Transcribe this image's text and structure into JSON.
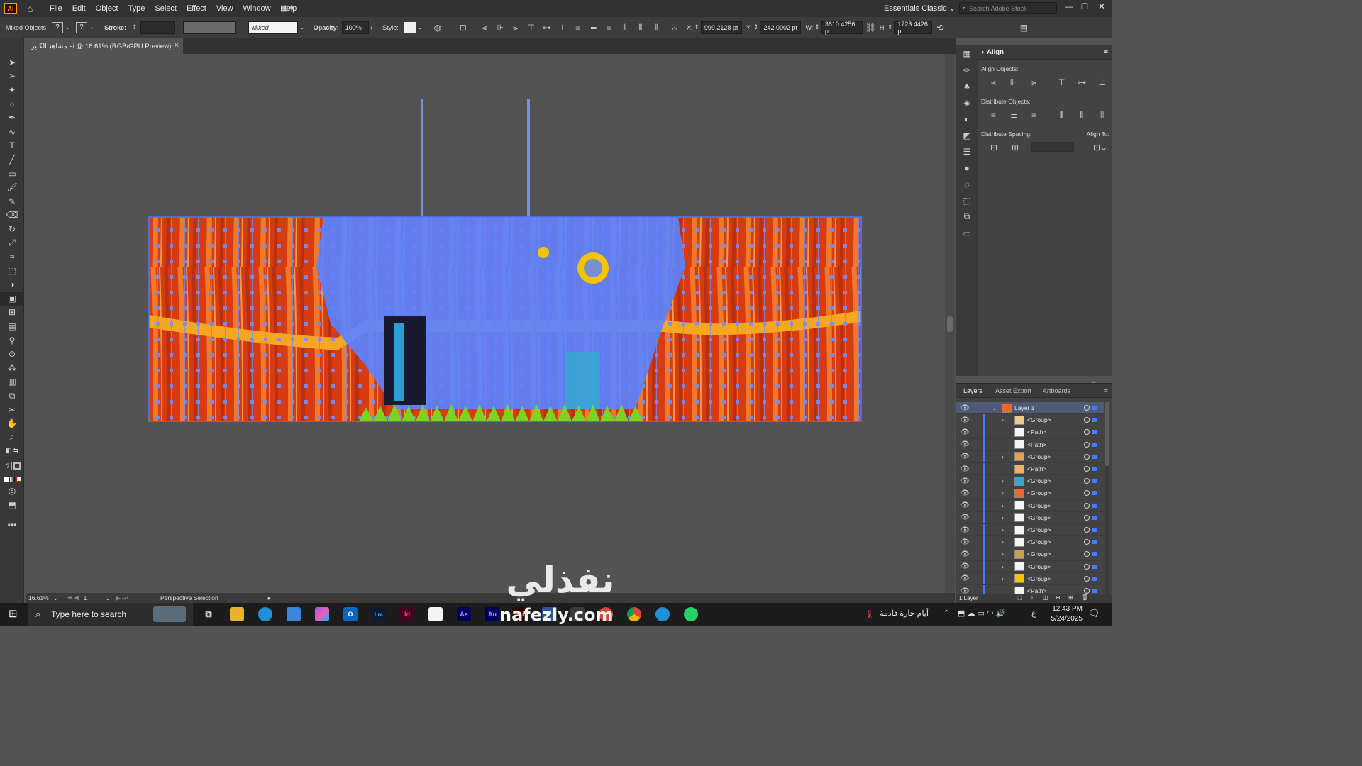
{
  "app": {
    "logo": "Ai",
    "menu": [
      "File",
      "Edit",
      "Object",
      "Type",
      "Select",
      "Effect",
      "View",
      "Window",
      "Help"
    ],
    "workspace": "Essentials Classic",
    "search_placeholder": "Search Adobe Stock"
  },
  "control": {
    "selection": "Mixed Objects",
    "stroke_label": "Stroke:",
    "brush_value": "Mixed",
    "opacity_label": "Opacity:",
    "opacity_value": "100%",
    "style_label": "Style:",
    "x_label": "X:",
    "x_value": "999.2128 pt",
    "y_label": "Y:",
    "y_value": "242.0002 pt",
    "w_label": "W:",
    "w_value": "3810.4256 p",
    "h_label": "H:",
    "h_value": "1723.4426 p"
  },
  "document": {
    "tab_title": "مشاهد الكبير.ai @ 16.61% (RGB/GPU Preview)",
    "zoom": "16.61%",
    "artboard": "1",
    "status": "Perspective Selection"
  },
  "align_panel": {
    "title": "Align",
    "align_objects": "Align Objects:",
    "distribute_objects": "Distribute Objects:",
    "distribute_spacing": "Distribute Spacing:",
    "align_to": "Align To:"
  },
  "layers_panel": {
    "tabs": [
      "Layers",
      "Asset Export",
      "Artboards"
    ],
    "layer_name": "Layer 1",
    "rows": [
      {
        "name": "<Group>",
        "expand": true
      },
      {
        "name": "<Path>",
        "expand": false
      },
      {
        "name": "<Path>",
        "expand": false
      },
      {
        "name": "<Group>",
        "expand": true
      },
      {
        "name": "<Path>",
        "expand": false
      },
      {
        "name": "<Group>",
        "expand": true
      },
      {
        "name": "<Group>",
        "expand": true
      },
      {
        "name": "<Group>",
        "expand": true
      },
      {
        "name": "<Group>",
        "expand": true
      },
      {
        "name": "<Group>",
        "expand": true
      },
      {
        "name": "<Group>",
        "expand": true
      },
      {
        "name": "<Group>",
        "expand": true
      },
      {
        "name": "<Group>",
        "expand": true
      },
      {
        "name": "<Group>",
        "expand": true
      },
      {
        "name": "<Path>",
        "expand": false
      }
    ],
    "footer": "1 Layer"
  },
  "taskbar": {
    "search_placeholder": "Type here to search",
    "apps": [
      "Lrc",
      "Id",
      "Ae",
      "Au"
    ],
    "weather": "أيام حارة قادمة",
    "lang": "ع",
    "time": "12:43 PM",
    "date": "5/24/2025"
  },
  "watermark": {
    "arabic": "نفذلي",
    "latin": "nafezly.com"
  },
  "colors": {
    "selection": "#4c78ff",
    "curtain_red": "#d63b12",
    "curtain_orange": "#f07a2a",
    "grass": "#7ed321"
  }
}
